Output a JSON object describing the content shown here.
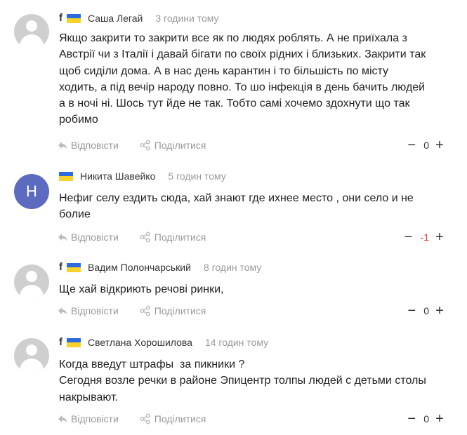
{
  "colors": {
    "flag_blue": "#2b6ae0",
    "flag_yellow": "#f7d229",
    "avatar_letter_bg": "#5c6bc0",
    "negative_score": "#e53935"
  },
  "actions": {
    "reply_label": "Відповісти",
    "share_label": "Поділитися",
    "reply_icon": "reply-icon",
    "share_icon": "share-icon"
  },
  "comments": [
    {
      "source_icon": "f",
      "author": "Саша Легай",
      "time": "3 години тому",
      "lines": [
        "Якщо закрити то закрити все як по людях роблять. А не приїхала з",
        "Австрії чи з Італії і давай бігати по своїх рідних і близьких. Закрити так",
        "щоб сиділи дома. А в нас день карантин і то більшість по місту",
        "ходить, а під вечір народу повно. То шо інфекція в день бачить людей",
        "а в ночі ні. Шось тут йде не так. Тобто самі хочемо здохнути що так",
        "робимо"
      ],
      "score": "0",
      "minus": "−",
      "plus": "+"
    },
    {
      "avatar_letter": "Н",
      "author": "Никита Шавейко",
      "time": "5 годин тому",
      "lines": [
        "Нефиг селу ездить сюда, хай знают где ихнее место , они село и не",
        "болие"
      ],
      "score": "-1",
      "minus": "−",
      "plus": "+"
    },
    {
      "source_icon": "f",
      "author": "Вадим Полончарський",
      "time": "8 годин тому",
      "lines": [
        "Ще хай відкриють речові ринки,"
      ],
      "score": "0",
      "minus": "−",
      "plus": "+"
    },
    {
      "source_icon": "f",
      "author": "Светлана Хорошилова",
      "time": "14 годин тому",
      "lines": [
        "Когда введут штрафы  за пикники ?",
        "Сегодня возле речки в районе Эпицентр толпы людей с детьми столы",
        "накрывают."
      ],
      "score": "0",
      "minus": "−",
      "plus": "+"
    }
  ]
}
